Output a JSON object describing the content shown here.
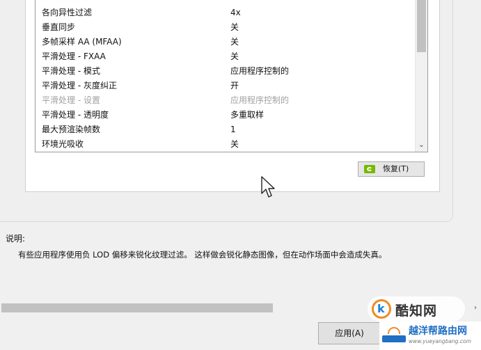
{
  "settings": {
    "rows": [
      {
        "name": "各向异性过滤",
        "value": "4x",
        "disabled": false
      },
      {
        "name": "垂直同步",
        "value": "关",
        "disabled": false
      },
      {
        "name": "多帧采样 AA (MFAA)",
        "value": "关",
        "disabled": false
      },
      {
        "name": "平滑处理 - FXAA",
        "value": "关",
        "disabled": false
      },
      {
        "name": "平滑处理 - 模式",
        "value": "应用程序控制的",
        "disabled": false
      },
      {
        "name": "平滑处理 - 灰度纠正",
        "value": "开",
        "disabled": false
      },
      {
        "name": "平滑处理 - 设置",
        "value": "应用程序控制的",
        "disabled": true
      },
      {
        "name": "平滑处理 - 透明度",
        "value": "多重取样",
        "disabled": false
      },
      {
        "name": "最大预渲染帧数",
        "value": "1",
        "disabled": false
      },
      {
        "name": "环境光吸收",
        "value": "关",
        "disabled": false
      }
    ]
  },
  "restore_label": "恢复(T)",
  "description": {
    "label": "说明:",
    "text": "有些应用程序使用负 LOD 偏移来锐化纹理过滤。 这样做会锐化静态图像，但在动作场面中会造成失真。"
  },
  "apply_label": "应用(A)",
  "watermark": {
    "top_text": "酷知网",
    "bottom_name": "越洋帮路由网",
    "bottom_url": "www.yueyangbang.com"
  },
  "icons": {
    "nvidia": "nvidia-logo-icon",
    "cursor": "mouse-cursor-icon",
    "scroll_down": "chevron-down-icon"
  },
  "colors": {
    "nvidia_green": "#76b900",
    "watermark_orange": "#f08a24",
    "watermark_blue": "#1f6fc4"
  }
}
